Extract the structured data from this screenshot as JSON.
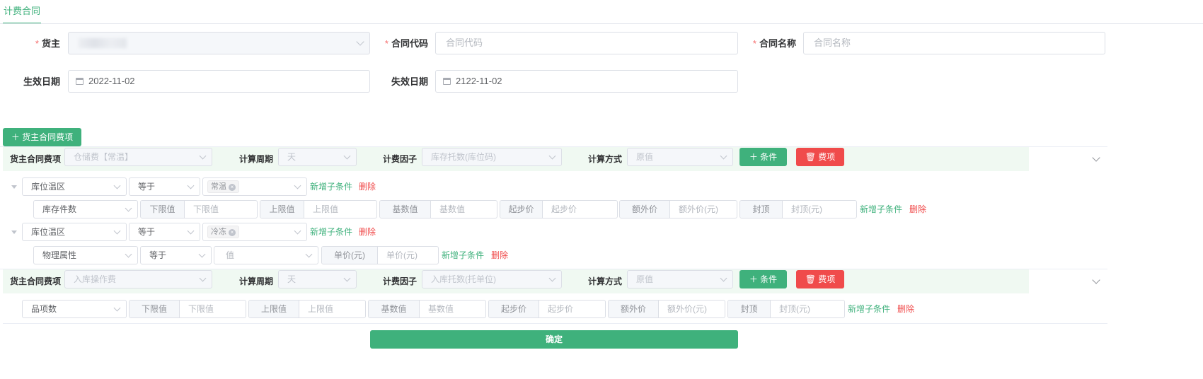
{
  "tab": {
    "label": "计费合同"
  },
  "form": {
    "owner": {
      "label": "货主",
      "required": true
    },
    "contract_code": {
      "label": "合同代码",
      "placeholder": "合同代码",
      "required": true
    },
    "contract_name": {
      "label": "合同名称",
      "placeholder": "合同名称",
      "required": true
    },
    "effective_date": {
      "label": "生效日期",
      "value": "2022-11-02"
    },
    "expire_date": {
      "label": "失效日期",
      "value": "2122-11-02"
    },
    "required_mark": "*"
  },
  "add_fee_item_button": "＋ 货主合同费项",
  "fee_items": [
    {
      "fee_item_label": "货主合同费项",
      "fee_item_value": "仓储费【常温】",
      "period_label": "计算周期",
      "period_value": "天",
      "factor_label": "计费因子",
      "factor_value": "库存托数(库位码)",
      "method_label": "计算方式",
      "method_value": "原值",
      "add_condition": "＋ 条件",
      "delete_fee": "费项"
    },
    {
      "fee_item_label": "货主合同费项",
      "fee_item_value": "入库操作费",
      "period_label": "计算周期",
      "period_value": "天",
      "factor_label": "计费因子",
      "factor_value": "入库托数(托单位)",
      "method_label": "计算方式",
      "method_value": "原值",
      "add_condition": "＋ 条件",
      "delete_fee": "费项"
    }
  ],
  "conditions": [
    {
      "field": "库位温区",
      "op": "等于",
      "tag": "常温",
      "add_sub": "新增子条件",
      "delete": "删除"
    },
    {
      "field": "库位温区",
      "op": "等于",
      "tag": "冷冻",
      "add_sub": "新增子条件",
      "delete": "删除"
    }
  ],
  "sub_rows": {
    "stock_pieces": {
      "field": "库存件数",
      "groups": [
        {
          "pre": "下限值",
          "ph": "下限值"
        },
        {
          "pre": "上限值",
          "ph": "上限值"
        },
        {
          "pre": "基数值",
          "ph": "基数值"
        },
        {
          "pre": "起步价",
          "ph": "起步价"
        },
        {
          "pre": "额外价",
          "ph": "额外价(元)"
        },
        {
          "pre": "封顶",
          "ph": "封顶(元)"
        }
      ],
      "add_sub": "新增子条件",
      "delete": "删除"
    },
    "physical": {
      "field": "物理属性",
      "op": "等于",
      "value_ph": "值",
      "price_pre": "单价(元)",
      "price_ph": "单价(元)",
      "add_sub": "新增子条件",
      "delete": "删除"
    },
    "item_count": {
      "field": "品项数",
      "groups": [
        {
          "pre": "下限值",
          "ph": "下限值"
        },
        {
          "pre": "上限值",
          "ph": "上限值"
        },
        {
          "pre": "基数值",
          "ph": "基数值"
        },
        {
          "pre": "起步价",
          "ph": "起步价"
        },
        {
          "pre": "额外价",
          "ph": "额外价(元)"
        },
        {
          "pre": "封顶",
          "ph": "封顶(元)"
        }
      ],
      "add_sub": "新增子条件",
      "delete": "删除"
    }
  },
  "confirm_button": "确定",
  "colors": {
    "primary": "#3fb17c",
    "danger": "#f04b4b",
    "band": "#f0f9f2"
  }
}
